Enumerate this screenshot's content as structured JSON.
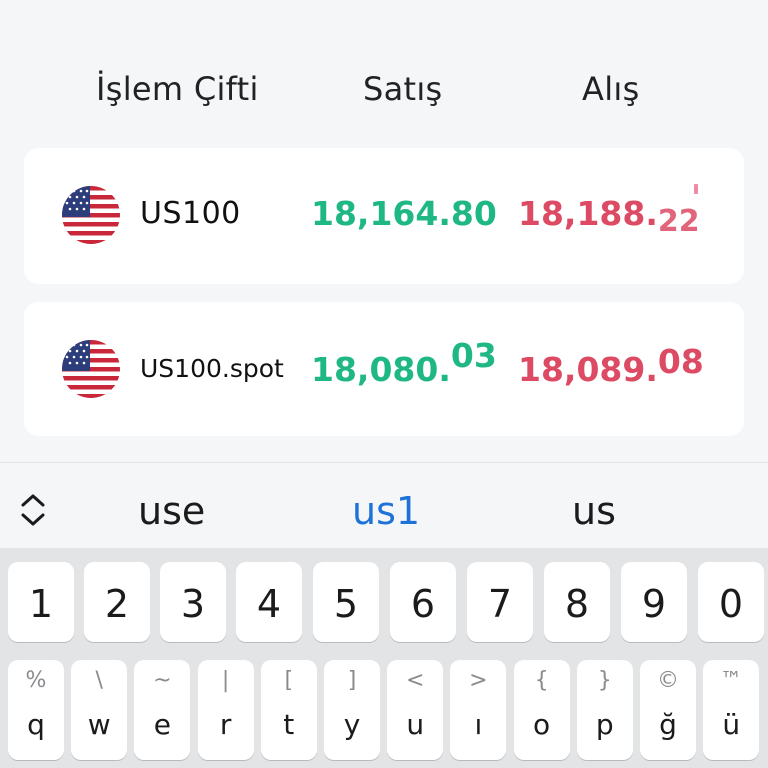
{
  "header": {
    "pair_label": "İşlem Çifti",
    "sell_label": "Satış",
    "buy_label": "Alış"
  },
  "instruments": [
    {
      "symbol": "US100",
      "flag": "us-flag-icon",
      "sell_main": "18,164.80",
      "sell_tail": "",
      "buy_main": "18,188.",
      "buy_tail": "22"
    },
    {
      "symbol": "US100.spot",
      "flag": "us-flag-icon",
      "sell_main": "18,080.",
      "sell_tail": "03",
      "buy_main": "18,089.",
      "buy_tail": "08"
    }
  ],
  "colors": {
    "sell": "#1fb884",
    "buy": "#dc4a64",
    "suggestion_active": "#1e73d8"
  },
  "keyboard": {
    "suggestions": [
      "use",
      "us1",
      "us"
    ],
    "number_row": [
      "1",
      "2",
      "3",
      "4",
      "5",
      "6",
      "7",
      "8",
      "9",
      "0"
    ],
    "letter_row": [
      {
        "main": "q",
        "alt": "%"
      },
      {
        "main": "w",
        "alt": "\\"
      },
      {
        "main": "e",
        "alt": "~"
      },
      {
        "main": "r",
        "alt": "|"
      },
      {
        "main": "t",
        "alt": "["
      },
      {
        "main": "y",
        "alt": "]"
      },
      {
        "main": "u",
        "alt": "<"
      },
      {
        "main": "ı",
        "alt": ">"
      },
      {
        "main": "o",
        "alt": "{"
      },
      {
        "main": "p",
        "alt": "}"
      },
      {
        "main": "ğ",
        "alt": "©"
      },
      {
        "main": "ü",
        "alt": "™"
      }
    ]
  }
}
